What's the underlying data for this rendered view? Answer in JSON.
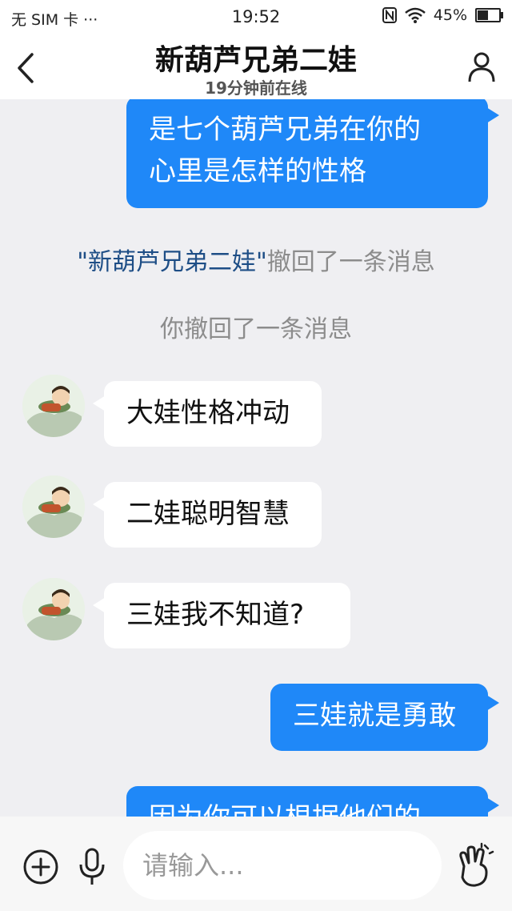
{
  "status_bar": {
    "carrier": "无 SIM 卡 ···",
    "time": "19:52",
    "battery": "45%",
    "battery_level": 0.45,
    "icons": [
      "nfc-icon",
      "wifi-icon",
      "battery-icon"
    ]
  },
  "header": {
    "title": "新葫芦兄弟二娃",
    "subtitle": "19分钟前在线",
    "back_icon": "chevron-left-icon",
    "profile_icon": "person-icon"
  },
  "messages": {
    "m1": "是七个葫芦兄弟在你的\n心里是怎样的性格",
    "recall_name": "\"新葫芦兄弟二娃\"",
    "recall_text": "撤回了一条消息",
    "self_recall": "你撤回了一条消息",
    "m2": "大娃性格冲动",
    "m3": "二娃聪明智慧",
    "m4": "三娃我不知道?",
    "m5": "三娃就是勇敢",
    "m6": "因为你可以根据他们的"
  },
  "input": {
    "placeholder": "请输入..."
  },
  "colors": {
    "outgoing_bubble": "#1f88f8",
    "incoming_bubble": "#ffffff",
    "background": "#efeff2",
    "recall_name": "#1e4e86"
  }
}
